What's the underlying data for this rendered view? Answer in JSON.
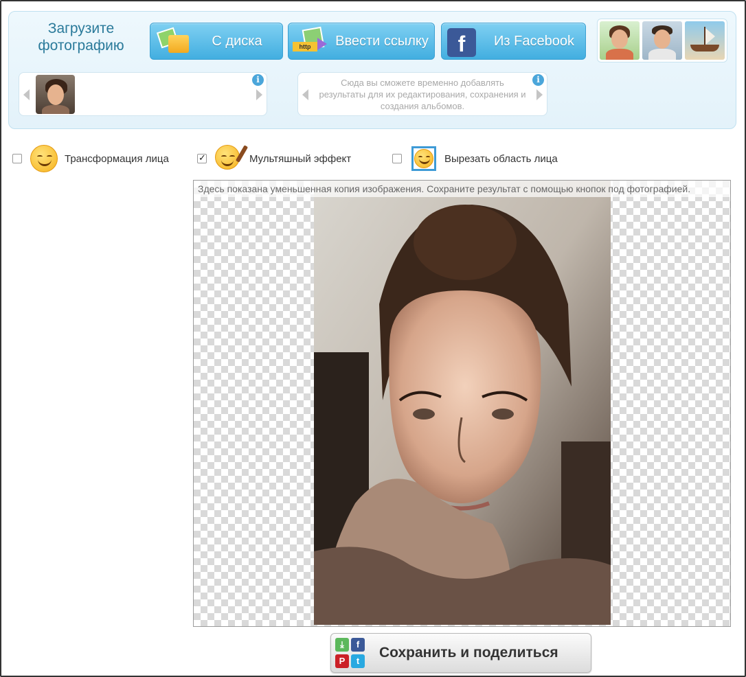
{
  "upload": {
    "title": "Загрузите фотографию",
    "buttons": {
      "disk": "С диска",
      "link": "Ввести ссылку",
      "link_icon_tag": "http",
      "facebook": "Из Facebook",
      "facebook_glyph": "f"
    }
  },
  "history_carousel": {
    "info": "i"
  },
  "results_carousel": {
    "text": "Сюда вы сможете временно добавлять результаты для их редактирования, сохранения и создания альбомов.",
    "info": "i"
  },
  "options": [
    {
      "label": "Трансформация лица",
      "checked": false,
      "icon": "smiley-face-icon"
    },
    {
      "label": "Мультяшный эффект",
      "checked": true,
      "icon": "cartoon-brush-icon"
    },
    {
      "label": "Вырезать область лица",
      "checked": false,
      "icon": "face-crop-icon"
    }
  ],
  "preview": {
    "note": "Здесь показана уменьшенная копия изображения. Сохраните результат с помощью кнопок под фотографией."
  },
  "save": {
    "label": "Сохранить и поделиться",
    "icons": {
      "download": "⤓",
      "facebook": "f",
      "pinterest": "P",
      "twitter": "t"
    }
  },
  "colors": {
    "button_blue": "#42aee0",
    "title_teal": "#2a7a9a",
    "facebook": "#3b5998"
  }
}
